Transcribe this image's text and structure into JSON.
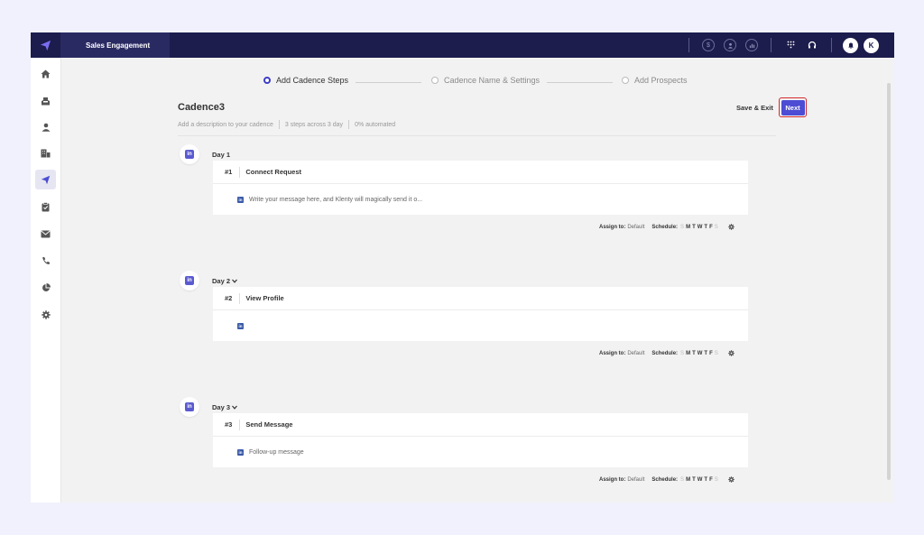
{
  "topbar": {
    "app_title": "Sales Engagement",
    "icons": [
      "dollar-icon",
      "user-circle-icon",
      "chart-icon",
      "dialpad-icon",
      "headset-icon",
      "bell-icon"
    ],
    "avatar_initial": "K"
  },
  "sidebar": {
    "items": [
      {
        "icon": "home-icon",
        "active": false
      },
      {
        "icon": "inbox-icon",
        "active": false
      },
      {
        "icon": "user-icon",
        "active": false
      },
      {
        "icon": "building-icon",
        "active": false
      },
      {
        "icon": "send-icon",
        "active": true
      },
      {
        "icon": "clipboard-icon",
        "active": false
      },
      {
        "icon": "mail-icon",
        "active": false
      },
      {
        "icon": "phone-icon",
        "active": false
      },
      {
        "icon": "pie-chart-icon",
        "active": false
      },
      {
        "icon": "gear-icon",
        "active": false
      }
    ]
  },
  "stepper": {
    "steps": [
      {
        "label": "Add Cadence Steps",
        "active": true
      },
      {
        "label": "Cadence Name & Settings",
        "active": false
      },
      {
        "label": "Add Prospects",
        "active": false
      }
    ]
  },
  "cadence": {
    "title": "Cadence3",
    "description_placeholder": "Add a description to your cadence",
    "steps_summary": "3 steps across 3 day",
    "automated": "0% automated"
  },
  "actions": {
    "save_exit": "Save & Exit",
    "next": "Next"
  },
  "footer_labels": {
    "assign_to": "Assign to:",
    "assignee": "Default",
    "schedule": "Schedule:",
    "days": [
      "S",
      "M",
      "T",
      "W",
      "T",
      "F",
      "S"
    ]
  },
  "days": [
    {
      "label": "Day 1",
      "chevron": false,
      "step_num": "#1",
      "step_name": "Connect Request",
      "body": "Write your message here, and Klenty will magically send it o..."
    },
    {
      "label": "Day 2",
      "chevron": true,
      "step_num": "#2",
      "step_name": "View Profile",
      "body": ""
    },
    {
      "label": "Day 3",
      "chevron": true,
      "step_num": "#3",
      "step_name": "Send Message",
      "body": "Follow-up message"
    }
  ],
  "colors": {
    "navy": "#1c1c4d",
    "accent": "#4c4cd4",
    "highlight_border": "#d42a2a"
  }
}
